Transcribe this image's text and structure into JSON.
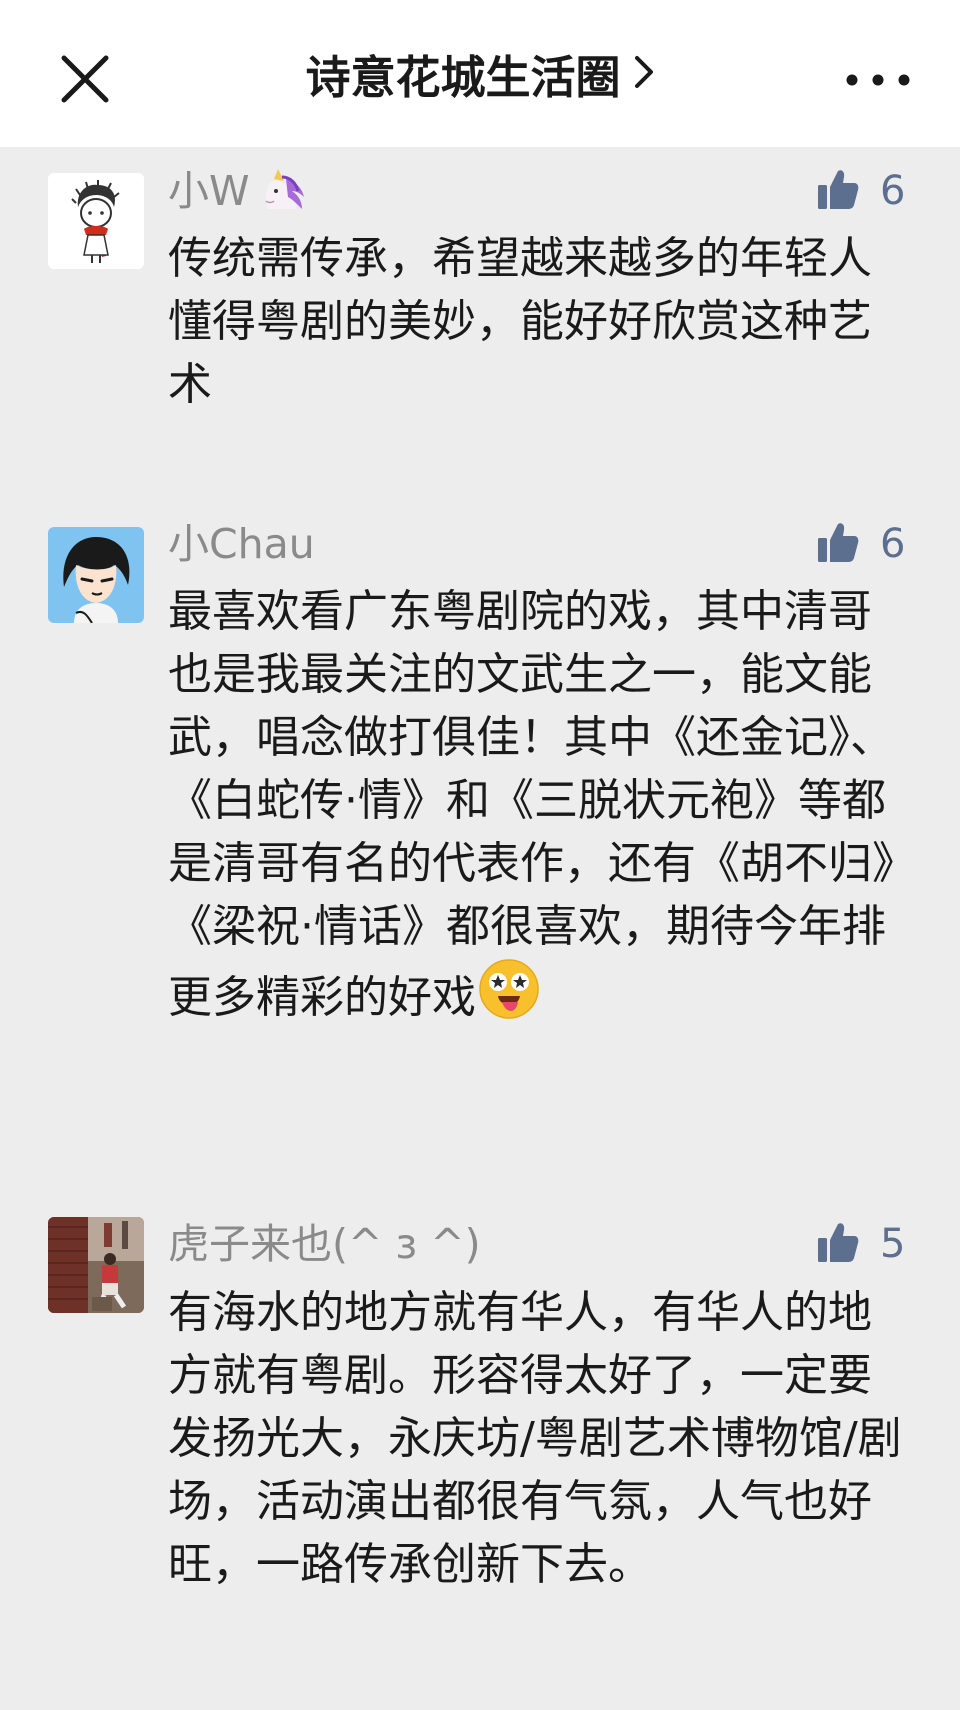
{
  "header": {
    "title": "诗意花城生活圈",
    "close_icon": "close-icon",
    "chevron_icon": "chevron-right-icon",
    "more_icon": "more-horizontal-icon"
  },
  "comments": [
    {
      "nickname": "小W",
      "nickname_emoji": "unicorn-emoji",
      "likes": "6",
      "text": "传统需传承，希望越来越多的年轻人懂得粤剧的美妙，能好好欣赏这种艺术"
    },
    {
      "nickname": "小Chau",
      "likes": "6",
      "text": "最喜欢看广东粤剧院的戏，其中清哥也是我最关注的文武生之一，能文能武，唱念做打俱佳！其中《还金记》、《白蛇传·情》和《三脱状元袍》等都是清哥有名的代表作，还有《胡不归》《梁祝·情话》都很喜欢，期待今年排更多精彩的好戏",
      "text_emoji": "star-struck-face-emoji"
    },
    {
      "nickname": "虎子来也(^ з ^)",
      "likes": "5",
      "text": "有海水的地方就有华人，有华人的地方就有粤剧。形容得太好了，一定要发扬光大，永庆坊/粤剧艺术博物馆/剧场，活动演出都很有气氛，人气也好旺，一路传承创新下去。"
    }
  ],
  "colors": {
    "background": "#ededed",
    "header_bg": "#ffffff",
    "nickname": "#8a8a8a",
    "like_accent": "#5c6f8f"
  }
}
